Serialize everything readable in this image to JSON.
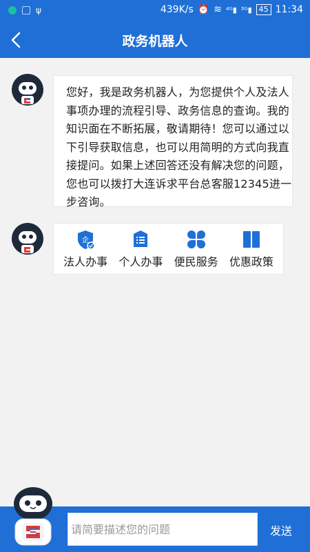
{
  "status_bar": {
    "speed": "439K/s",
    "battery": "45",
    "time": "11:34"
  },
  "nav": {
    "title": "政务机器人"
  },
  "greeting": {
    "text": "您好，我是政务机器人，为您提供个人及法人事项办理的流程引导、政务信息的查询。我的知识面在不断拓展，敬请期待！您可以通过以下引导获取信息，也可以用简明的方式向我直接提问。如果上述回答还没有解决您的问题，您也可以拨打大连诉求平台总客服12345进一步咨询。"
  },
  "actions": [
    {
      "label": "法人办事",
      "icon": "enterprise-shield-icon"
    },
    {
      "label": "个人办事",
      "icon": "list-document-icon"
    },
    {
      "label": "便民服务",
      "icon": "four-petal-icon"
    },
    {
      "label": "优惠政策",
      "icon": "open-book-icon"
    }
  ],
  "input": {
    "placeholder": "请简要描述您的问题"
  },
  "send": {
    "label": "发送"
  },
  "colors": {
    "primary": "#1f6fd6",
    "background": "#f2f2f2"
  }
}
